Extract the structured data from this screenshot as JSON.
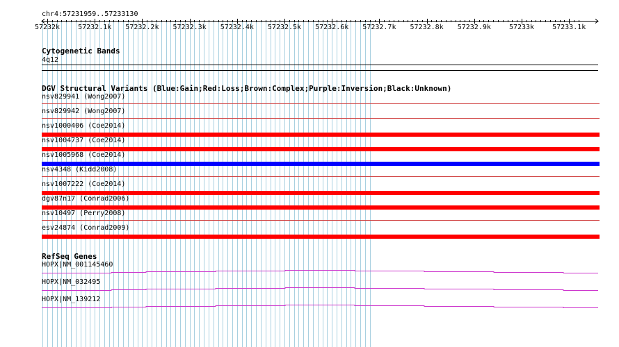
{
  "location": "chr4:57231959..57233130",
  "ruler": {
    "ticks": [
      "57232k",
      "57232.1k",
      "57232.2k",
      "57232.3k",
      "57232.4k",
      "57232.5k",
      "57232.6k",
      "57232.7k",
      "57232.8k",
      "57232.9k",
      "57233k",
      "57233.1k"
    ]
  },
  "colors": {
    "grid": "#a8d0e0",
    "gain": "#0000ff",
    "loss": "#ff0000",
    "thin_line": "#d04040",
    "gene": "#cc33cc"
  },
  "tracks": {
    "cytobands": {
      "title": "Cytogenetic Bands",
      "band": "4q12"
    },
    "dgv": {
      "title": "DGV Structural Variants (Blue:Gain;Red:Loss;Brown:Complex;Purple:Inversion;Black:Unknown)",
      "features": [
        {
          "label": "nsv829941 (Wong2007)",
          "type": "loss",
          "style": "thin"
        },
        {
          "label": "nsv829942 (Wong2007)",
          "type": "loss",
          "style": "thin"
        },
        {
          "label": "nsv1000406 (Coe2014)",
          "type": "loss",
          "style": "thick"
        },
        {
          "label": "nsv1004737 (Coe2014)",
          "type": "loss",
          "style": "thick"
        },
        {
          "label": "nsv1005968 (Coe2014)",
          "type": "gain",
          "style": "thick"
        },
        {
          "label": "nsv4348 (Kidd2008)",
          "type": "loss",
          "style": "thin"
        },
        {
          "label": "nsv1007222 (Coe2014)",
          "type": "loss",
          "style": "thick"
        },
        {
          "label": "dgv87n17 (Conrad2006)",
          "type": "loss",
          "style": "thick"
        },
        {
          "label": "nsv10497 (Perry2008)",
          "type": "loss",
          "style": "thin"
        },
        {
          "label": "esv24874 (Conrad2009)",
          "type": "loss",
          "style": "thick"
        }
      ]
    },
    "refseq": {
      "title": "RefSeq Genes",
      "genes": [
        {
          "label": "HOPX|NM_001145460"
        },
        {
          "label": "HOPX|NM_032495"
        },
        {
          "label": "HOPX|NM_139212"
        }
      ]
    }
  }
}
